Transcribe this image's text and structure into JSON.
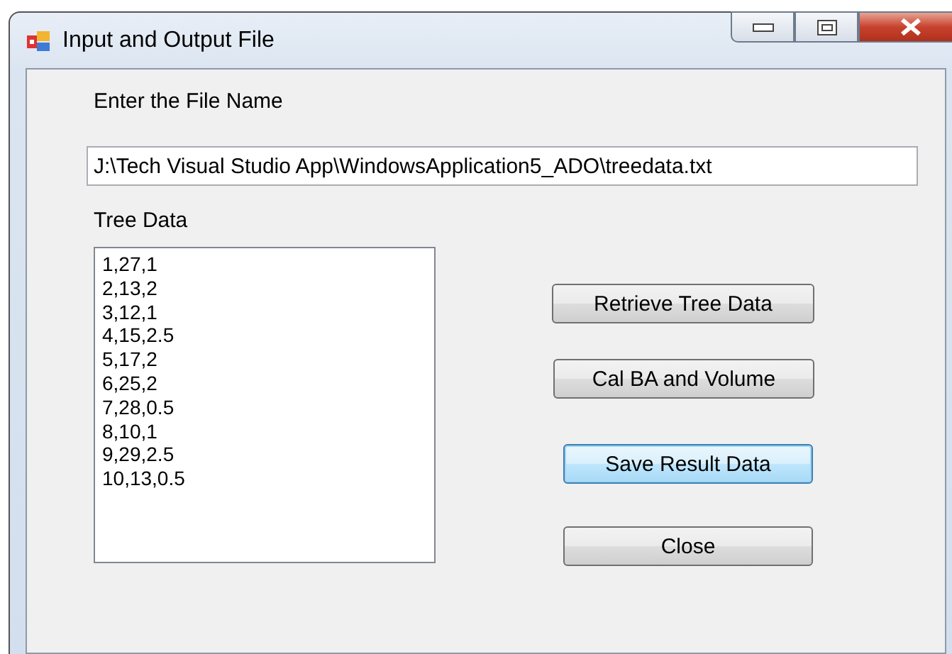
{
  "window": {
    "title": "Input and Output File"
  },
  "file_label": "Enter the File Name",
  "file_field": {
    "value": "J:\\Tech Visual Studio App\\WindowsApplication5_ADO\\treedata.txt"
  },
  "list_label": "Tree Data",
  "tree_data": [
    "1,27,1",
    "2,13,2",
    "3,12,1",
    "4,15,2.5",
    "5,17,2",
    "6,25,2",
    "7,28,0.5",
    "8,10,1",
    "9,29,2.5",
    "10,13,0.5"
  ],
  "buttons": [
    {
      "label": "Retrieve Tree Data",
      "focused": false
    },
    {
      "label": "Cal BA and Volume",
      "focused": false
    },
    {
      "label": "Save Result Data",
      "focused": true
    },
    {
      "label": "Close",
      "focused": false
    }
  ]
}
